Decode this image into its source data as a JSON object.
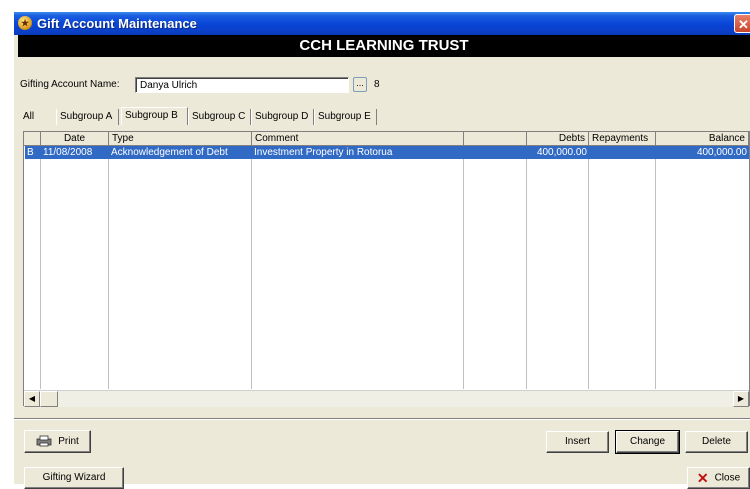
{
  "window": {
    "title": "Gift Account Maintenance"
  },
  "banner": "CCH LEARNING TRUST",
  "account": {
    "label": "Gifting Account Name:",
    "value": "Danya Ulrich",
    "ellipsis": "...",
    "count": "8"
  },
  "tabs": [
    "All",
    "Subgroup A",
    "Subgroup B",
    "Subgroup C",
    "Subgroup D",
    "Subgroup E"
  ],
  "active_tab": "Subgroup B",
  "grid": {
    "columns": [
      "",
      "Date",
      "Type",
      "Comment",
      "",
      "Debts",
      "Repayments",
      "Balance"
    ],
    "rows": [
      {
        "marker": "B",
        "date": "11/08/2008",
        "type": "Acknowledgement of Debt",
        "comment": "Investment Property in Rotorua",
        "extra": "",
        "debts": "400,000.00",
        "repayments": "",
        "balance": "400,000.00"
      }
    ]
  },
  "buttons": {
    "print": "Print",
    "insert": "Insert",
    "change": "Change",
    "delete": "Delete",
    "wizard": "Gifting Wizard",
    "close": "Close"
  },
  "icons": {
    "app": "gift-app-icon",
    "print": "printer-icon",
    "close": "red-x-icon"
  },
  "colors": {
    "selection": "#316ac5",
    "title_bar": "#0a46d8",
    "banner": "#000000"
  }
}
